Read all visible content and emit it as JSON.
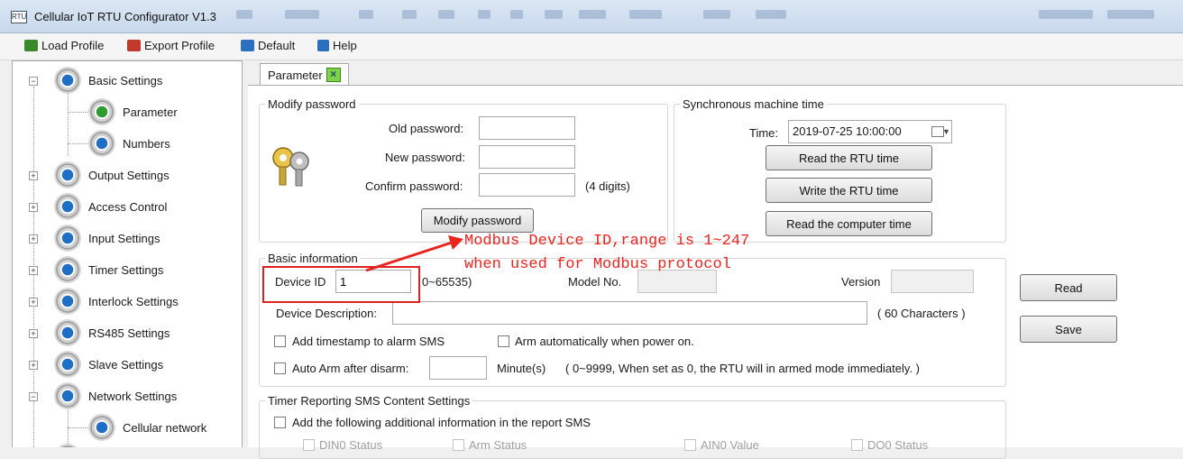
{
  "window": {
    "title": "Cellular IoT RTU Configurator V1.3",
    "app_icon_text": "RTU"
  },
  "menu": [
    {
      "label": "Load Profile",
      "icon": "load-profile-icon",
      "color": "#3a8a2a"
    },
    {
      "label": "Export Profile",
      "icon": "export-profile-icon",
      "color": "#c0392b"
    },
    {
      "label": "Default",
      "icon": "default-icon",
      "color": "#2a6fc0"
    },
    {
      "label": "Help",
      "icon": "help-icon",
      "color": "#2a6fc0"
    }
  ],
  "sidebar": {
    "items": [
      {
        "label": "Basic Settings",
        "expander": "−"
      },
      {
        "label": "Parameter"
      },
      {
        "label": "Numbers"
      },
      {
        "label": "Output Settings",
        "expander": "+"
      },
      {
        "label": "Access Control",
        "expander": "+"
      },
      {
        "label": "Input Settings",
        "expander": "+"
      },
      {
        "label": "Timer Settings",
        "expander": "+"
      },
      {
        "label": "Interlock Settings",
        "expander": "+"
      },
      {
        "label": "RS485 Settings",
        "expander": "+"
      },
      {
        "label": "Slave Settings",
        "expander": "+"
      },
      {
        "label": "Network Settings",
        "expander": "−"
      },
      {
        "label": "Cellular network"
      }
    ]
  },
  "tab": {
    "label": "Parameter",
    "close_icon": "close-icon"
  },
  "password": {
    "legend": "Modify password",
    "old_label": "Old password:",
    "new_label": "New password:",
    "confirm_label": "Confirm password:",
    "digits_hint": "(4 digits)",
    "old_value": "",
    "new_value": "",
    "confirm_value": "",
    "button": "Modify password"
  },
  "sync": {
    "legend": "Synchronous machine time",
    "time_label": "Time:",
    "time_value": "2019-07-25 10:00:00",
    "read_rtu": "Read the RTU time",
    "write_rtu": "Write the RTU time",
    "read_computer": "Read the computer time"
  },
  "basic": {
    "legend": "Basic information",
    "device_id_label": "Device ID",
    "device_id_value": "1",
    "device_id_range": "0~65535)",
    "model_label": "Model No.",
    "model_value": "",
    "version_label": "Version",
    "version_value": "",
    "desc_label": "Device Description:",
    "desc_value": "",
    "desc_hint": "( 60 Characters )",
    "timestamp_label": "Add timestamp to alarm SMS",
    "arm_power_label": "Arm automatically when power on.",
    "auto_arm_label": "Auto Arm after disarm:",
    "auto_arm_value": "",
    "minutes_label": "Minute(s)",
    "minutes_hint": "( 0~9999, When set as 0, the RTU will in armed mode immediately. )"
  },
  "side_buttons": {
    "read": "Read",
    "save": "Save"
  },
  "timer_report": {
    "legend": "Timer Reporting SMS Content Settings",
    "add_info_label": "Add the following additional information in the report SMS",
    "options": [
      "DIN0 Status",
      "Arm Status",
      "AIN0 Value",
      "DO0 Status"
    ]
  },
  "annotation": {
    "line1": "Modbus Device ID,range is 1~247",
    "line2": "when used for Modbus protocol",
    "color": "#e8241f"
  }
}
